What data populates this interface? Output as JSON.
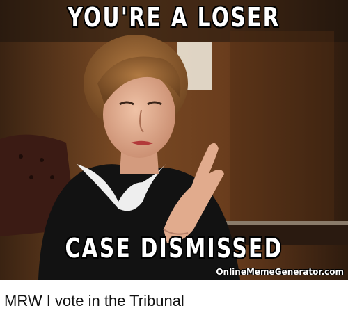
{
  "meme": {
    "top_text": "YOU'RE A LOSER",
    "bottom_text": "CASE DISMISSED",
    "watermark": "OnlineMemeGenerator.com"
  },
  "caption": "MRW I vote in the Tribunal",
  "colors": {
    "background_wood": "#6b3f1f",
    "robe": "#111111",
    "collar_lace": "#eeeeee",
    "hair": "#8a5a2b",
    "skin": "#e2b095",
    "text": "#ffffff"
  }
}
